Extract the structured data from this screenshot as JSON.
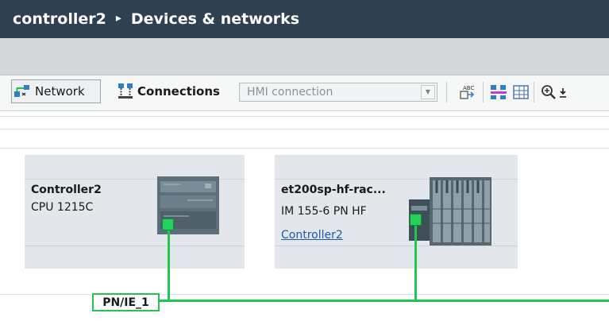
{
  "breadcrumb": {
    "project": "controller2",
    "separator": "▸",
    "section": "Devices & networks"
  },
  "toolbar": {
    "network_label": "Network",
    "connections_label": "Connections",
    "connection_type": {
      "value": "HMI connection"
    },
    "icons": [
      "network-view-icon",
      "connections-icon",
      "dropdown-arrow-icon",
      "rename-icon",
      "show-address-icon",
      "table-icon",
      "zoom-in-icon",
      "zoom-menu-arrow-icon"
    ]
  },
  "devices": [
    {
      "name": "Controller2",
      "type": "CPU 1215C",
      "link": ""
    },
    {
      "name": "et200sp-hf-rac...",
      "type": "IM 155-6 PN HF",
      "link": "Controller2"
    }
  ],
  "subnet": {
    "label": "PN/IE_1"
  },
  "colors": {
    "titlebar": "#2f4050",
    "profinet": "#22c552",
    "device_bg": "#e3e6ea",
    "link": "#1e5aa8"
  }
}
